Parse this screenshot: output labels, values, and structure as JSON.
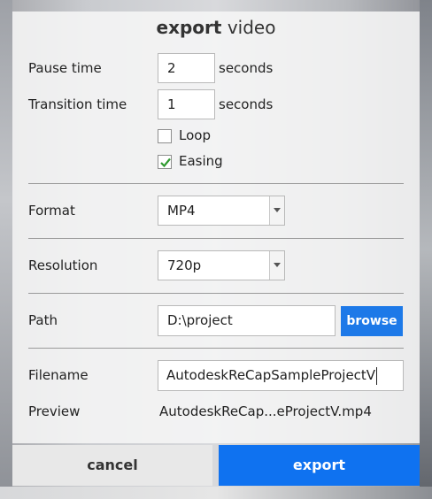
{
  "dialog": {
    "title_bold": "export",
    "title_rest": " video"
  },
  "fields": {
    "pause_time": {
      "label": "Pause time",
      "value": "2",
      "unit": "seconds"
    },
    "transition_time": {
      "label": "Transition time",
      "value": "1",
      "unit": "seconds"
    },
    "loop": {
      "label": "Loop",
      "checked": false
    },
    "easing": {
      "label": "Easing",
      "checked": true
    },
    "format": {
      "label": "Format",
      "value": "MP4"
    },
    "resolution": {
      "label": "Resolution",
      "value": "720p"
    },
    "path": {
      "label": "Path",
      "value": "D:\\project",
      "browse_label": "browse"
    },
    "filename": {
      "label": "Filename",
      "value": "AutodeskReCapSampleProjectV"
    },
    "preview": {
      "label": "Preview",
      "value": "AutodeskReCap...eProjectV.mp4"
    }
  },
  "actions": {
    "cancel_label": "cancel",
    "export_label": "export"
  },
  "colors": {
    "accent": "#1d79e8",
    "export_button": "#0f72f0",
    "checkmark": "#2f9a2f"
  }
}
